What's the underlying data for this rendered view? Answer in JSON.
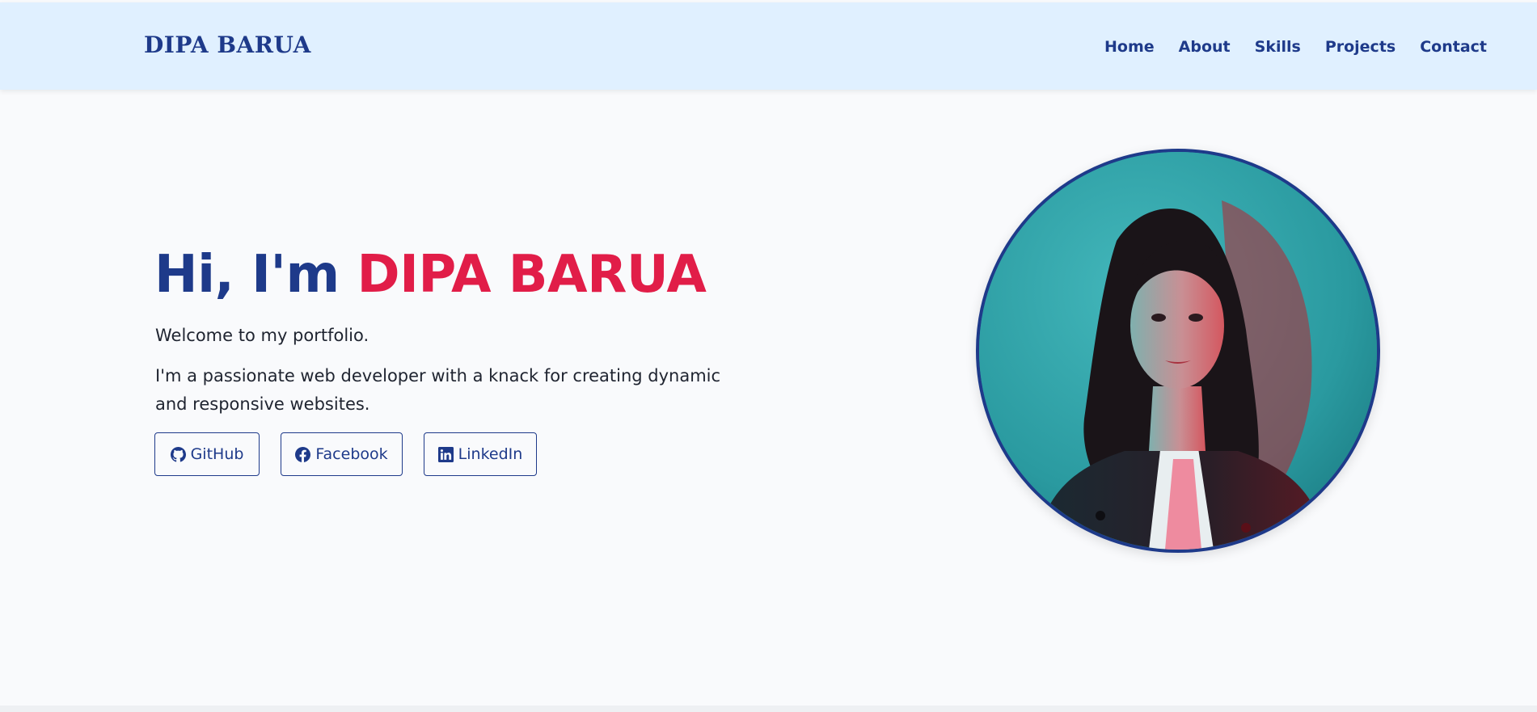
{
  "nav": {
    "brand": "DIPA BARUA",
    "links": [
      "Home",
      "About",
      "Skills",
      "Projects",
      "Contact"
    ]
  },
  "hero": {
    "greeting": "Hi, I'm ",
    "name": "DIPA BARUA",
    "welcome": "Welcome to my portfolio.",
    "description": "I'm a passionate web developer with a knack for creating dynamic and responsive websites.",
    "buttons": [
      {
        "label": "GitHub",
        "icon": "github-icon"
      },
      {
        "label": "Facebook",
        "icon": "facebook-icon"
      },
      {
        "label": "LinkedIn",
        "icon": "linkedin-icon"
      }
    ]
  },
  "colors": {
    "primary": "#1e3a8a",
    "accent": "#e11d48",
    "nav_bg": "#e0f0ff",
    "page_bg": "#f9fafc"
  }
}
